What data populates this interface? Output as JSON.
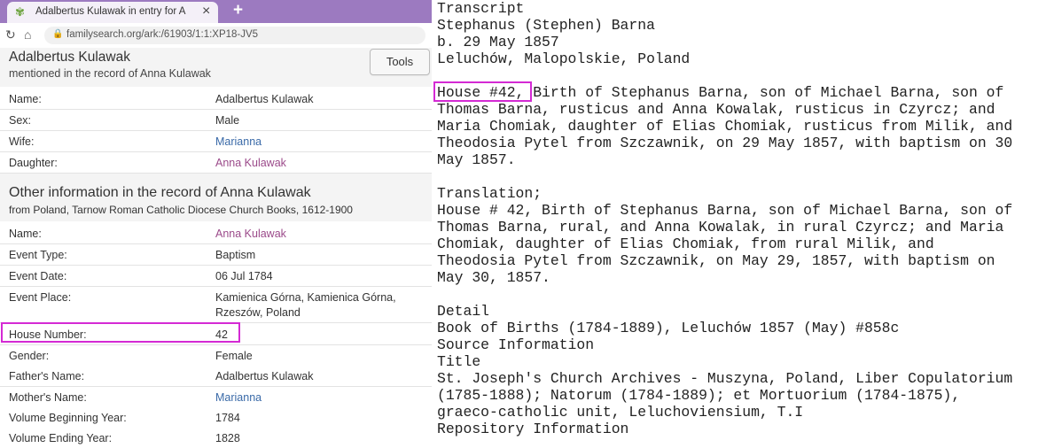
{
  "browser": {
    "tab_title": "Adalbertus Kulawak in entry for A",
    "tab_close": "×",
    "new_tab": "+",
    "url": "familysearch.org/ark:/61903/1:1:XP18-JV5"
  },
  "person": {
    "name": "Adalbertus Kulawak",
    "subtitle": "mentioned in the record of Anna Kulawak",
    "tools_label": "Tools",
    "rows": [
      {
        "key": "Name:",
        "value": "Adalbertus Kulawak"
      },
      {
        "key": "Sex:",
        "value": "Male"
      },
      {
        "key": "Wife:",
        "value": "Marianna"
      },
      {
        "key": "Daughter:",
        "value": "Anna Kulawak"
      }
    ]
  },
  "other": {
    "heading": "Other information in the record of Anna Kulawak",
    "subheading": "from Poland, Tarnow Roman Catholic Diocese Church Books, 1612-1900",
    "rows": [
      {
        "key": "Name:",
        "value": "Anna Kulawak"
      },
      {
        "key": "Event Type:",
        "value": "Baptism"
      },
      {
        "key": "Event Date:",
        "value": "06 Jul 1784"
      },
      {
        "key": "Event Place:",
        "value": "Kamienica Górna, Kamienica Górna,",
        "value2": "Rzeszów, Poland"
      },
      {
        "key": "House Number:",
        "value": "42"
      },
      {
        "key": "Gender:",
        "value": "Female"
      },
      {
        "key": "Father's Name:",
        "value": "Adalbertus Kulawak"
      },
      {
        "key": "Mother's Name:",
        "value": "Marianna"
      },
      {
        "key": "Volume Beginning Year:",
        "value": "1784"
      },
      {
        "key": "Volume Ending Year:",
        "value": "1828"
      }
    ]
  },
  "transcript": {
    "lines": [
      "Transcript",
      "Stephanus (Stephen) Barna",
      "b. 29 May 1857",
      "Leluchów, Malopolskie, Poland",
      "",
      "House #42, Birth of Stephanus Barna, son of Michael Barna, son of",
      "Thomas Barna, rusticus and Anna Kowalak, rusticus in Czyrcz; and",
      "Maria Chomiak, daughter of Elias Chomiak, rusticus from Milik, and",
      "Theodosia Pytel from Szczawnik, on 29 May 1857, with baptism on 30",
      "May 1857.",
      "",
      "Translation;",
      "House # 42, Birth of Stephanus Barna, son of Michael Barna, son of",
      "Thomas Barna, rural, and Anna Kowalak, in rural Czyrcz; and Maria",
      "Chomiak, daughter of Elias Chomiak, from rural Milik, and",
      "Theodosia Pytel from Szczawnik, on May 29, 1857, with baptism on",
      "May 30, 1857.",
      "",
      "Detail",
      "Book of Births (1784-1889), Leluchów 1857 (May) #858c",
      "Source Information",
      "Title",
      "St. Joseph's Church Archives - Muszyna, Poland, Liber Copulatorium",
      "(1785-1888); Natorum (1784-1889); et Mortuorium (1784-1875),",
      "graeco-catholic unit, Leluchoviensium, T.I",
      "Repository Information"
    ]
  },
  "colors": {
    "tabbar": "#9c7ac0",
    "highlight": "#d42ad4",
    "link_blue": "#3a6aa8",
    "link_purple": "#9b4a8a"
  }
}
